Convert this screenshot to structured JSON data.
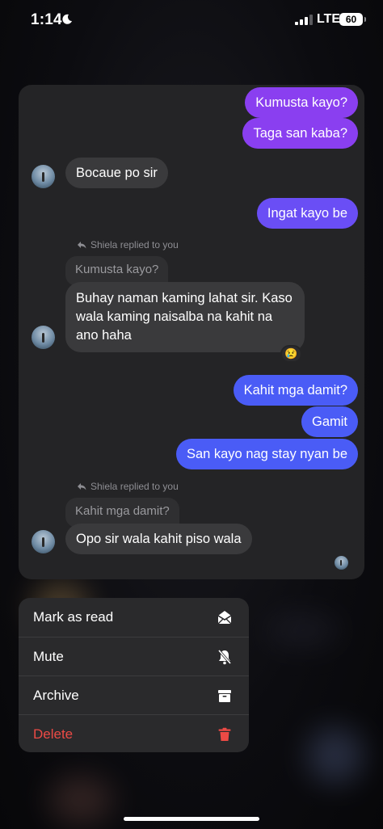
{
  "status_bar": {
    "time": "1:14",
    "network": "LTE",
    "battery": "60"
  },
  "chat": {
    "messages": [
      {
        "text": "Kumusta kayo?"
      },
      {
        "text": "Taga san kaba?"
      },
      {
        "text": "Bocaue po sir"
      },
      {
        "text": "Ingat kayo be"
      },
      {
        "replied_label": "Shiela replied to you",
        "quoted": "Kumusta kayo?"
      },
      {
        "text": "Buhay naman kaming lahat sir. Kaso wala kaming naisalba na kahit na ano haha",
        "line1": "Buhay naman kaming lahat sir. Kaso",
        "line2": "wala kaming naisalba na kahit na",
        "line3": "ano haha",
        "reaction": "😢"
      },
      {
        "text": "Kahit mga damit?"
      },
      {
        "text": "Gamit"
      },
      {
        "text": "San kayo nag stay nyan be"
      },
      {
        "replied_label": "Shiela replied to you",
        "quoted": "Kahit mga damit?"
      },
      {
        "text": "Opo sir wala kahit piso wala"
      }
    ]
  },
  "menu": {
    "items": [
      {
        "label": "Mark as read",
        "icon": "envelope-open-icon"
      },
      {
        "label": "Mute",
        "icon": "bell-slash-icon"
      },
      {
        "label": "Archive",
        "icon": "archive-box-icon"
      },
      {
        "label": "Delete",
        "icon": "trash-icon",
        "color": "#ec4a45"
      }
    ]
  },
  "colors": {
    "outgoing_purple": "#8a3ff0",
    "outgoing_violet": "#6a4ef5",
    "outgoing_blue": "#4a5cf6",
    "incoming": "#3a3a3c",
    "delete": "#ec4a45"
  }
}
